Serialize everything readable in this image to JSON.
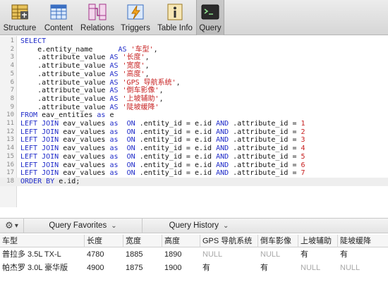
{
  "toolbar": {
    "items": [
      {
        "label": "Structure",
        "icon": "structure-icon"
      },
      {
        "label": "Content",
        "icon": "content-icon"
      },
      {
        "label": "Relations",
        "icon": "relations-icon"
      },
      {
        "label": "Triggers",
        "icon": "triggers-icon"
      },
      {
        "label": "Table Info",
        "icon": "table-info-icon"
      },
      {
        "label": "Query",
        "icon": "terminal-icon"
      }
    ],
    "active": "Query"
  },
  "editor": {
    "current_line": 18,
    "lines": [
      {
        "n": "1",
        "text": "SELECT"
      },
      {
        "n": "2",
        "text": "    e.entity_name      AS '车型',"
      },
      {
        "n": "3",
        "text": "    v1.attribute_value AS '长度',"
      },
      {
        "n": "4",
        "text": "    v2.attribute_value AS '宽度',"
      },
      {
        "n": "5",
        "text": "    v3.attribute_value AS '高度',"
      },
      {
        "n": "6",
        "text": "    v4.attribute_value AS 'GPS 导航系统',"
      },
      {
        "n": "7",
        "text": "    v5.attribute_value AS '倒车影像',"
      },
      {
        "n": "8",
        "text": "    v6.attribute_value AS '上坡辅助',"
      },
      {
        "n": "9",
        "text": "    v7.attribute_value AS '陡坡缓降'"
      },
      {
        "n": "10",
        "text": "FROM eav_entities as e"
      },
      {
        "n": "11",
        "text": "LEFT JOIN eav_values as v1 ON v1.entity_id = e.id AND v1.attribute_id = 1"
      },
      {
        "n": "12",
        "text": "LEFT JOIN eav_values as v2 ON v2.entity_id = e.id AND v2.attribute_id = 2"
      },
      {
        "n": "13",
        "text": "LEFT JOIN eav_values as v3 ON v3.entity_id = e.id AND v3.attribute_id = 3"
      },
      {
        "n": "14",
        "text": "LEFT JOIN eav_values as v4 ON v4.entity_id = e.id AND v4.attribute_id = 4"
      },
      {
        "n": "15",
        "text": "LEFT JOIN eav_values as v5 ON v5.entity_id = e.id AND v5.attribute_id = 5"
      },
      {
        "n": "16",
        "text": "LEFT JOIN eav_values as v6 ON v6.entity_id = e.id AND v6.attribute_id = 6"
      },
      {
        "n": "17",
        "text": "LEFT JOIN eav_values as v7 ON v7.entity_id = e.id AND v7.attribute_id = 7"
      },
      {
        "n": "18",
        "text": "ORDER BY e.id;"
      }
    ]
  },
  "query_bar": {
    "gear_icon": "gear-icon",
    "favorites_label": "Query Favorites",
    "history_label": "Query History"
  },
  "results": {
    "columns": [
      "车型",
      "长度",
      "宽度",
      "高度",
      "GPS 导航系统",
      "倒车影像",
      "上坡辅助",
      "陡坡缓降"
    ],
    "rows": [
      [
        "普拉多 3.5L TX-L",
        "4780",
        "1885",
        "1890",
        "NULL",
        "NULL",
        "有",
        "有"
      ],
      [
        "帕杰罗 3.0L 豪华版",
        "4900",
        "1875",
        "1900",
        "有",
        "有",
        "NULL",
        "NULL"
      ]
    ]
  },
  "colors": {
    "keyword": "#1f2bc9",
    "string": "#c72020",
    "null": "#a8a8a8"
  }
}
